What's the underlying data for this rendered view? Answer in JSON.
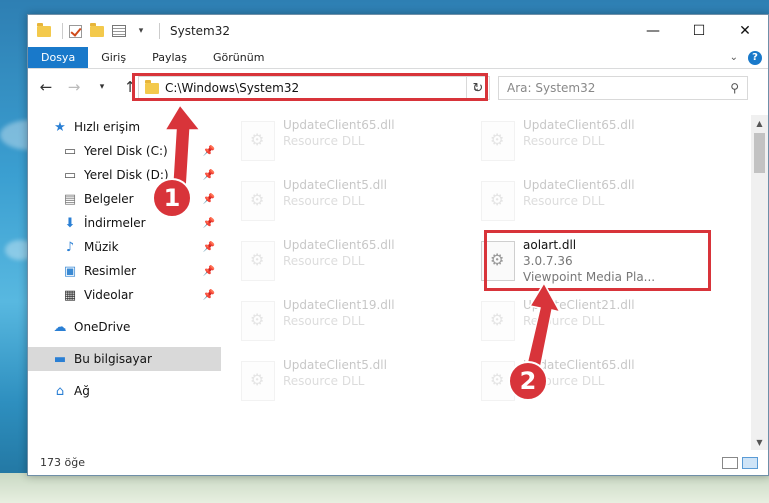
{
  "window": {
    "title": "System32",
    "controls": {
      "minimize": "—",
      "maximize": "☐",
      "close": "✕"
    }
  },
  "ribbon": {
    "tabs": [
      "Dosya",
      "Giriş",
      "Paylaş",
      "Görünüm"
    ],
    "help": "?"
  },
  "nav": {
    "address": "C:\\Windows\\System32",
    "search_placeholder": "Ara: System32"
  },
  "sidebar": {
    "items": [
      {
        "label": "Hızlı erişim",
        "icon": "star-icon"
      },
      {
        "label": "Yerel Disk (C:)",
        "icon": "drive-icon",
        "pinned": true
      },
      {
        "label": "Yerel Disk (D:)",
        "icon": "drive-icon",
        "pinned": true
      },
      {
        "label": "Belgeler",
        "icon": "document-icon",
        "pinned": true
      },
      {
        "label": "İndirmeler",
        "icon": "download-icon",
        "pinned": true
      },
      {
        "label": "Müzik",
        "icon": "music-icon",
        "pinned": true
      },
      {
        "label": "Resimler",
        "icon": "pictures-icon",
        "pinned": true
      },
      {
        "label": "Videolar",
        "icon": "video-icon",
        "pinned": true
      },
      {
        "label": "OneDrive",
        "icon": "cloud-icon"
      },
      {
        "label": "Bu bilgisayar",
        "icon": "computer-icon"
      },
      {
        "label": "Ağ",
        "icon": "network-icon"
      }
    ]
  },
  "files": [
    {
      "name": "UpdateClient65.dll",
      "sub": "Resource DLL"
    },
    {
      "name": "UpdateClient65.dll",
      "sub": "Resource DLL"
    },
    {
      "name": "UpdateClient5.dll",
      "sub": "Resource DLL"
    },
    {
      "name": "UpdateClient65.dll",
      "sub": "Resource DLL"
    },
    {
      "name": "UpdateClient65.dll",
      "sub": "Resource DLL"
    },
    {
      "name": "aolart.dll",
      "sub": "3.0.7.36",
      "sub2": "Viewpoint Media Pla..."
    },
    {
      "name": "UpdateClient19.dll",
      "sub": "Resource DLL"
    },
    {
      "name": "UpdateClient21.dll",
      "sub": "Resource DLL"
    },
    {
      "name": "UpdateClient5.dll",
      "sub": "Resource DLL"
    },
    {
      "name": "UpdateClient65.dll",
      "sub": "Resource DLL"
    }
  ],
  "status": {
    "count": "173 öğe"
  },
  "annotations": {
    "step1": "1",
    "step2": "2"
  },
  "colors": {
    "accent": "#1979ca",
    "highlight": "#d8343a"
  }
}
